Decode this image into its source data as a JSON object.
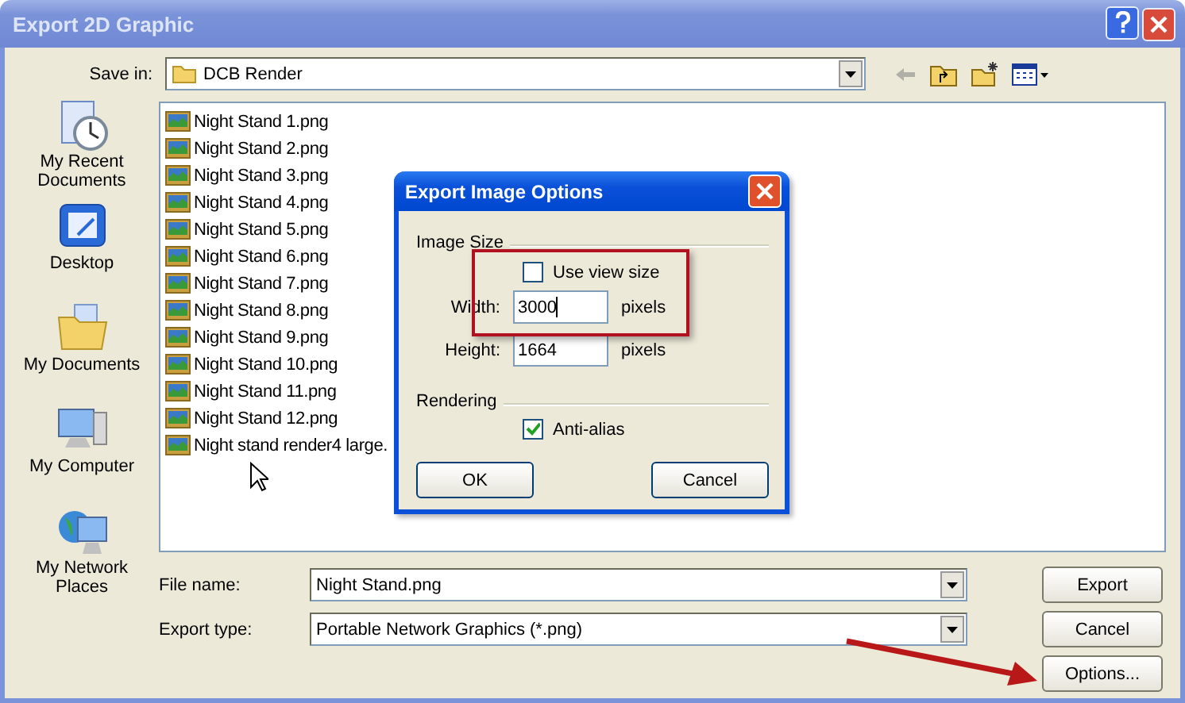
{
  "window": {
    "title": "Export 2D Graphic"
  },
  "save_in": {
    "label": "Save in:",
    "value": "DCB Render"
  },
  "places": [
    {
      "label": "My Recent Documents",
      "kind": "recent"
    },
    {
      "label": "Desktop",
      "kind": "desktop"
    },
    {
      "label": "My Documents",
      "kind": "documents"
    },
    {
      "label": "My Computer",
      "kind": "computer"
    },
    {
      "label": "My Network Places",
      "kind": "network"
    }
  ],
  "files": [
    "Night Stand 1.png",
    "Night Stand 2.png",
    "Night Stand 3.png",
    "Night Stand 4.png",
    "Night Stand 5.png",
    "Night Stand 6.png",
    "Night Stand 7.png",
    "Night Stand 8.png",
    "Night Stand 9.png",
    "Night Stand 10.png",
    "Night Stand 11.png",
    "Night Stand 12.png",
    "Night stand render4 large."
  ],
  "file_name": {
    "label": "File name:",
    "value": "Night Stand.png"
  },
  "export_type": {
    "label": "Export type:",
    "value": "Portable Network Graphics (*.png)"
  },
  "buttons": [
    "Export",
    "Cancel",
    "Options..."
  ],
  "options_dialog": {
    "title": "Export Image Options",
    "image_size_label": "Image Size",
    "use_view_size": {
      "label": "Use view size",
      "checked": false
    },
    "width": {
      "label": "Width:",
      "value": "3000",
      "unit": "pixels"
    },
    "height": {
      "label": "Height:",
      "value": "1664",
      "unit": "pixels"
    },
    "rendering_label": "Rendering",
    "anti_alias": {
      "label": "Anti-alias",
      "checked": true
    },
    "buttons": [
      "OK",
      "Cancel"
    ]
  }
}
